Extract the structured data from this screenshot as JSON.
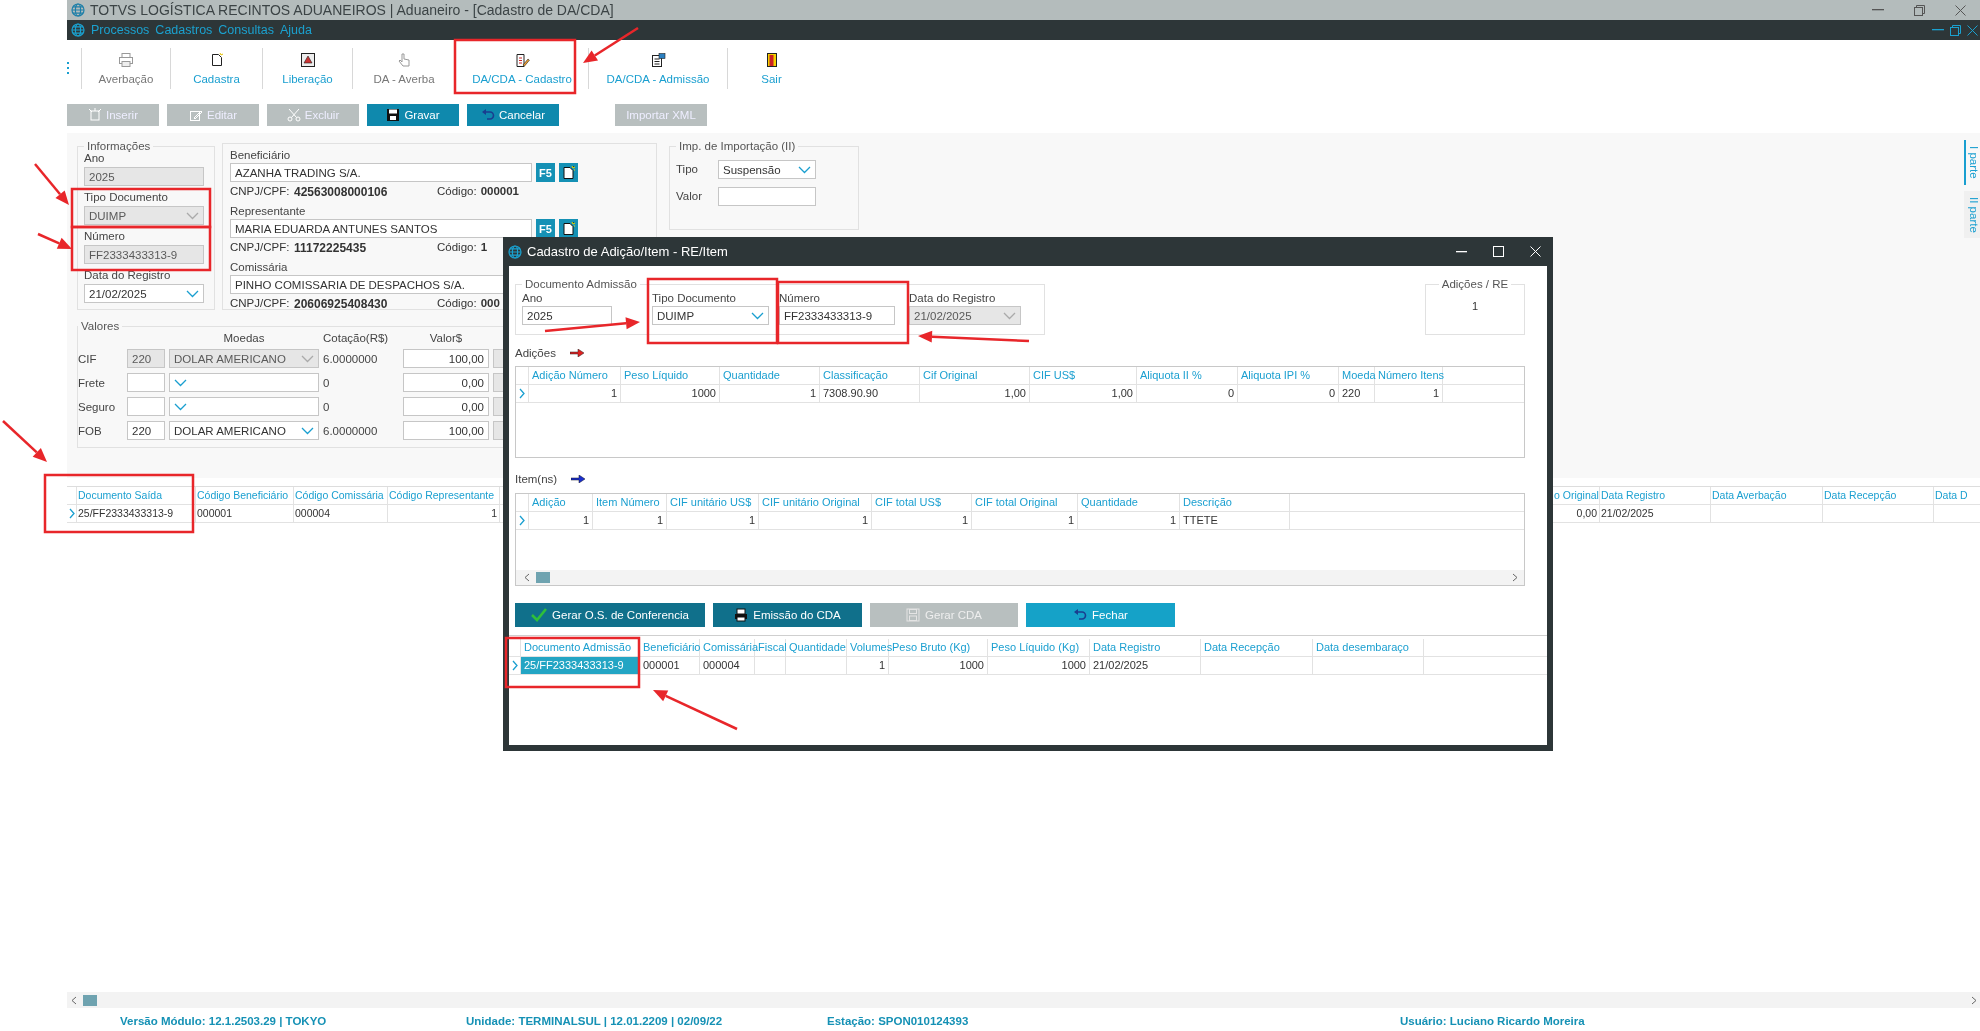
{
  "window": {
    "title": "TOTVS LOGÍSTICA RECINTOS ADUANEIROS | Aduaneiro - [Cadastro de DA/CDA]"
  },
  "menu": [
    "Processos",
    "Cadastros",
    "Consultas",
    "Ajuda"
  ],
  "toolbar": [
    {
      "label": "Averbação",
      "disabled": true
    },
    {
      "label": "Cadastra",
      "disabled": false
    },
    {
      "label": "Liberação",
      "disabled": false
    },
    {
      "label": "DA - Averba",
      "disabled": true
    },
    {
      "label": "DA/CDA - Cadastro",
      "disabled": false
    },
    {
      "label": "DA/CDA - Admissão",
      "disabled": false
    },
    {
      "label": "Sair",
      "disabled": false
    }
  ],
  "actions": [
    {
      "label": "Inserir",
      "disabled": true
    },
    {
      "label": "Editar",
      "disabled": true
    },
    {
      "label": "Excluir",
      "disabled": true
    },
    {
      "label": "Gravar",
      "disabled": false
    },
    {
      "label": "Cancelar",
      "disabled": false
    },
    {
      "label": "Importar XML",
      "disabled": true
    }
  ],
  "informacoes": {
    "title": "Informações",
    "fields": [
      {
        "label": "Ano",
        "value": "2025",
        "kind": "text",
        "disabled": true
      },
      {
        "label": "Tipo Documento",
        "value": "DUIMP",
        "kind": "select",
        "disabled": true
      },
      {
        "label": "Número",
        "value": "FF2333433313-9",
        "kind": "text",
        "disabled": true
      },
      {
        "label": "Data do Registro",
        "value": "21/02/2025",
        "kind": "select",
        "disabled": false
      }
    ]
  },
  "parties": [
    {
      "label": "Beneficiário",
      "value": "AZANHA TRADING S/A.",
      "cnpj_label": "CNPJ/CPF:",
      "cnpj": "42563008000106",
      "code_label": "Código:",
      "code": "000001",
      "lookup": "F5"
    },
    {
      "label": "Representante",
      "value": "MARIA EDUARDA ANTUNES SANTOS",
      "cnpj_label": "CNPJ/CPF:",
      "cnpj": "11172225435",
      "code_label": "Código:",
      "code": "1",
      "lookup": "F5"
    },
    {
      "label": "Comissária",
      "value": "PINHO COMISSARIA DE DESPACHOS S/A.",
      "cnpj_label": "CNPJ/CPF:",
      "cnpj": "20606925408430",
      "code_label": "Código:",
      "code": "000"
    }
  ],
  "imposto_ii": {
    "title": "Imp. de Importação (II)",
    "tipo_label": "Tipo",
    "tipo": "Suspensão",
    "valor_label": "Valor"
  },
  "valores": {
    "title": "Valores",
    "columns": [
      "Moedas",
      "Cotação(R$)",
      "Valor$"
    ],
    "rows": [
      {
        "label": "CIF",
        "code": "220",
        "currency": "DOLAR AMERICANO",
        "rate": "6.0000000",
        "value": "100,00",
        "disabled": true
      },
      {
        "label": "Frete",
        "rate": "0",
        "value": "0,00",
        "disabled": false
      },
      {
        "label": "Seguro",
        "rate": "0",
        "value": "0,00",
        "disabled": false
      },
      {
        "label": "FOB",
        "code": "220",
        "currency": "DOLAR AMERICANO",
        "rate": "6.0000000",
        "value": "100,00",
        "disabled": false
      }
    ]
  },
  "documents_grid": {
    "columns": [
      "Documento Saída",
      "Código Beneficiário",
      "Código Comissária",
      "Código Representante",
      "o Original",
      "Data Registro",
      "Data Averbação",
      "Data Recepção",
      "Data D"
    ],
    "rows": [
      {
        "cells": [
          "25/FF2333433313-9",
          "000001",
          "000004",
          "1",
          "0,00",
          "21/02/2025",
          null,
          null,
          null
        ],
        "selected": false
      }
    ]
  },
  "side_tabs": [
    {
      "label": "I parte",
      "selected": true
    },
    {
      "label": "II parte",
      "selected": false
    }
  ],
  "dialog": {
    "title": "Cadastro de Adição/Item - RE/Item",
    "document": {
      "title": "Documento Admissão",
      "fields": [
        {
          "label": "Ano",
          "value": "2025",
          "kind": "text",
          "disabled": false
        },
        {
          "label": "Tipo Documento",
          "value": "DUIMP",
          "kind": "select",
          "disabled": false
        },
        {
          "label": "Número",
          "value": "FF2333433313-9",
          "kind": "text",
          "disabled": false
        },
        {
          "label": "Data do Registro",
          "value": "21/02/2025",
          "kind": "select",
          "disabled": true
        }
      ]
    },
    "adicoes_re": {
      "title": "Adições / RE",
      "value": "1"
    },
    "adicoes": {
      "title": "Adições",
      "columns": [
        "Adição Número",
        "Peso Líquido",
        "Quantidade",
        "Classificação",
        "Cif Original",
        "CIF US$",
        "Aliquota II %",
        "Aliquota IPI %",
        "Moeda",
        "Número Itens"
      ],
      "rows": [
        {
          "cells": [
            "1",
            "1000",
            "1",
            "7308.90.90",
            "1,00",
            "1,00",
            "0",
            "0",
            "220",
            "1"
          ],
          "selected": false
        }
      ]
    },
    "itens": {
      "title": "Item(ns)",
      "columns": [
        "Adição",
        "Item Número",
        "CIF unitário US$",
        "CIF unitário Original",
        "CIF total US$",
        "CIF total Original",
        "Quantidade",
        "Descrição"
      ],
      "rows": [
        {
          "cells": [
            "1",
            "1",
            "1",
            "1",
            "1",
            "1",
            "1",
            "TTETE"
          ],
          "selected": false
        }
      ]
    },
    "buttons": [
      {
        "label": "Gerar O.S. de Conferencia",
        "disabled": false
      },
      {
        "label": "Emissão do CDA",
        "disabled": false
      },
      {
        "label": "Gerar CDA",
        "disabled": true
      },
      {
        "label": "Fechar",
        "disabled": false
      }
    ],
    "admissao_grid": {
      "columns": [
        "Documento Admissão",
        "Beneficiário",
        "Comissária",
        "Fiscal",
        "Quantidade",
        "Volumes",
        "Peso Bruto (Kg)",
        "Peso Líquido (Kg)",
        "Data Registro",
        "Data Recepção",
        "Data desembaraço"
      ],
      "rows": [
        {
          "cells": [
            "25/FF2333433313-9",
            "000001",
            "000004",
            null,
            null,
            "1",
            "1000",
            "1000",
            "21/02/2025",
            null,
            null
          ],
          "selected": true
        }
      ]
    }
  },
  "status_bar": [
    "Versão Módulo: 12.1.2503.29 | TOKYO",
    "Unidade: TERMINALSUL | 12.01.2209 | 02/09/22",
    "Estação: SPON010124393",
    "Usuário: Luciano Ricardo Moreira"
  ]
}
